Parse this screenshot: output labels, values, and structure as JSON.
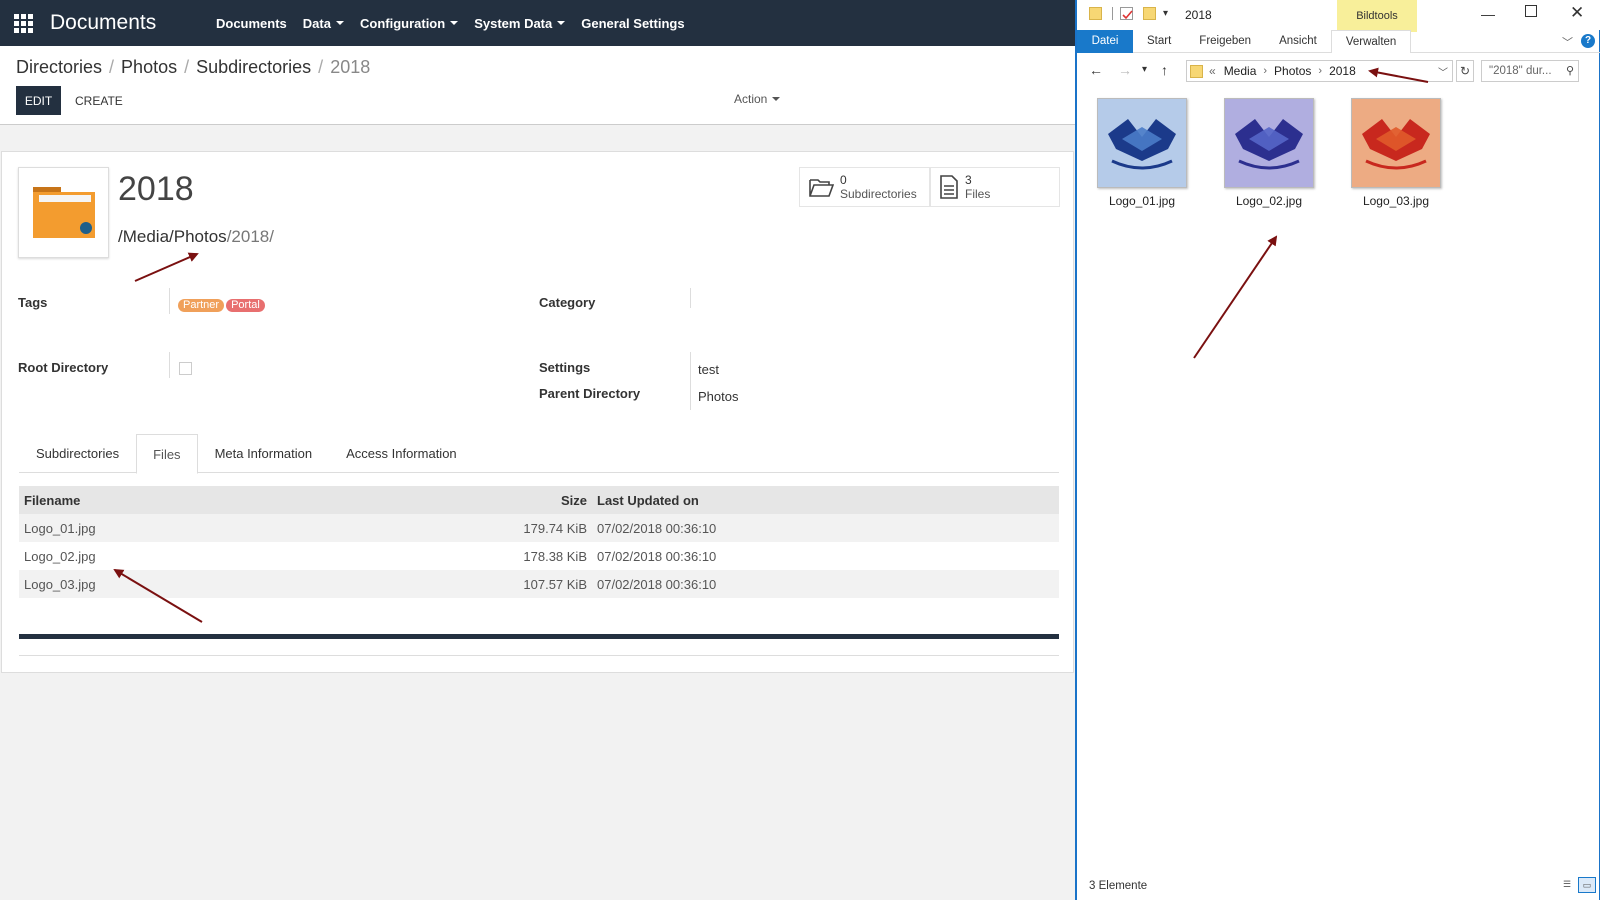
{
  "topbar": {
    "brand": "Documents",
    "menu": [
      {
        "label": "Documents",
        "dropdown": false
      },
      {
        "label": "Data",
        "dropdown": true
      },
      {
        "label": "Configuration",
        "dropdown": true
      },
      {
        "label": "System Data",
        "dropdown": true
      },
      {
        "label": "General Settings",
        "dropdown": false
      }
    ]
  },
  "breadcrumb": [
    "Directories",
    "Photos",
    "Subdirectories",
    "2018"
  ],
  "buttons": {
    "edit": "EDIT",
    "create": "CREATE",
    "action": "Action"
  },
  "record": {
    "title": "2018",
    "path_prefix": "/Media/Photos",
    "path_suffix": "/2018/",
    "stats": {
      "subdirs_count": "0",
      "subdirs_label": "Subdirectories",
      "files_count": "3",
      "files_label": "Files"
    },
    "fields": {
      "tags_label": "Tags",
      "tags": [
        {
          "name": "Partner",
          "color": "#f0a05a"
        },
        {
          "name": "Portal",
          "color": "#e86f6f"
        }
      ],
      "category_label": "Category",
      "root_label": "Root Directory",
      "settings_label": "Settings",
      "settings_value": "test",
      "parent_label": "Parent Directory",
      "parent_value": "Photos"
    }
  },
  "tabs": [
    {
      "label": "Subdirectories",
      "active": false
    },
    {
      "label": "Files",
      "active": true
    },
    {
      "label": "Meta Information",
      "active": false
    },
    {
      "label": "Access Information",
      "active": false
    }
  ],
  "files_table": {
    "headers": {
      "name": "Filename",
      "size": "Size",
      "updated": "Last Updated on"
    },
    "rows": [
      {
        "name": "Logo_01.jpg",
        "size": "179.74 KiB",
        "updated": "07/02/2018 00:36:10"
      },
      {
        "name": "Logo_02.jpg",
        "size": "178.38 KiB",
        "updated": "07/02/2018 00:36:10"
      },
      {
        "name": "Logo_03.jpg",
        "size": "107.57 KiB",
        "updated": "07/02/2018 00:36:10"
      }
    ]
  },
  "explorer": {
    "title": "2018",
    "bildtools": "Bildtools",
    "ribbon": [
      "Datei",
      "Start",
      "Freigeben",
      "Ansicht",
      "Verwalten"
    ],
    "help": "?",
    "address": [
      "«",
      "Media",
      "Photos",
      "2018"
    ],
    "search_placeholder": "\"2018\" dur...",
    "thumbnails": [
      {
        "name": "Logo_01.jpg",
        "palette": [
          "#1b3a8a",
          "#d8e6f5",
          "#4a7cc8"
        ]
      },
      {
        "name": "Logo_02.jpg",
        "palette": [
          "#2c2f8f",
          "#cfc6e8",
          "#5566c8"
        ]
      },
      {
        "name": "Logo_03.jpg",
        "palette": [
          "#c8281e",
          "#f2c6a0",
          "#e05a2a"
        ]
      }
    ],
    "status": "3 Elemente"
  },
  "colors": {
    "navbar": "#233040",
    "explorer_accent": "#1979ca",
    "annotation_arrow": "#7a1010",
    "folder": "#f39c2f"
  }
}
